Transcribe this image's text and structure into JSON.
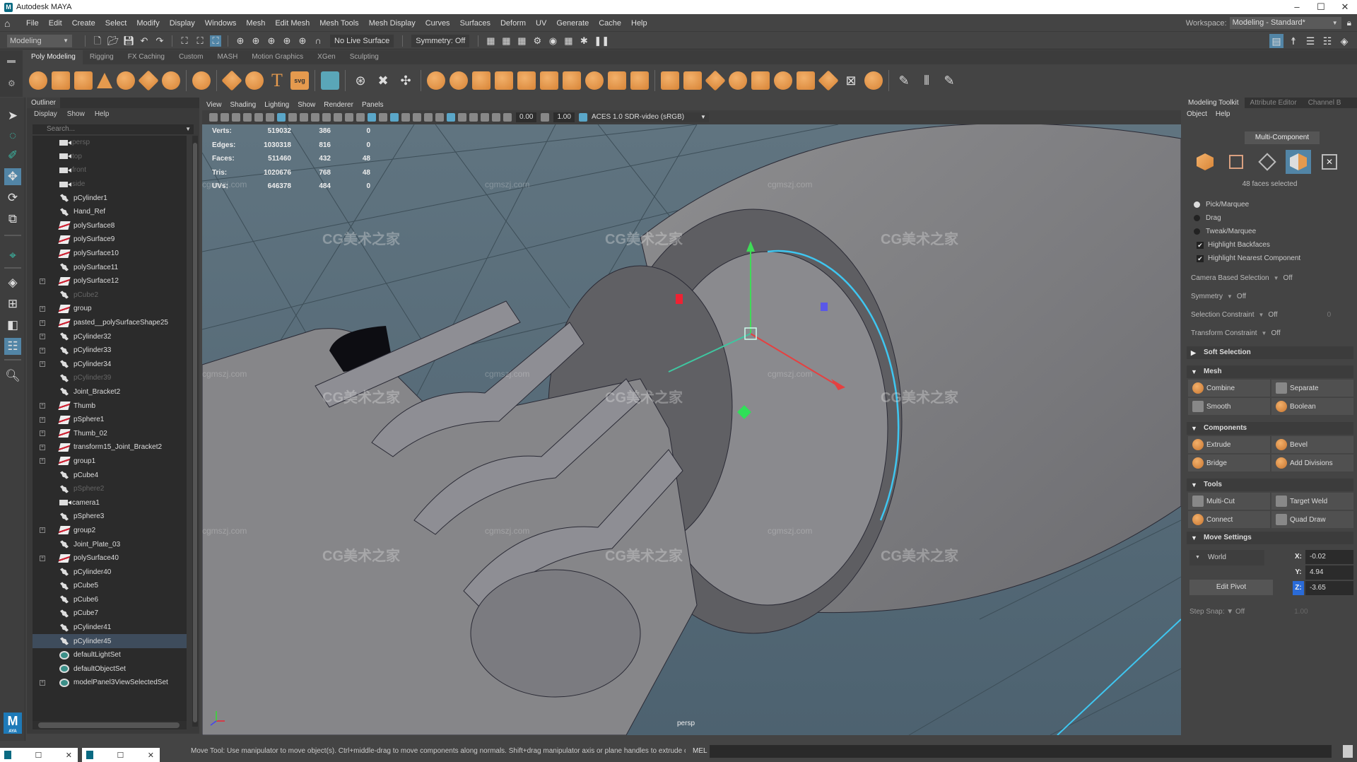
{
  "window": {
    "title": "Autodesk MAYA",
    "controls": [
      "–",
      "☐",
      "✕"
    ]
  },
  "menubar": {
    "items": [
      "File",
      "Edit",
      "Create",
      "Select",
      "Modify",
      "Display",
      "Windows",
      "Mesh",
      "Edit Mesh",
      "Mesh Tools",
      "Mesh Display",
      "Curves",
      "Surfaces",
      "Deform",
      "UV",
      "Generate",
      "Cache",
      "Help"
    ],
    "workspace_label": "Workspace:",
    "workspace_value": "Modeling - Standard*"
  },
  "statusline": {
    "mode": "Modeling",
    "live_surface": "No Live Surface",
    "symmetry": "Symmetry: Off"
  },
  "shelf": {
    "tabs": [
      "Poly Modeling",
      "Rigging",
      "FX Caching",
      "Custom",
      "MASH",
      "Motion Graphics",
      "XGen",
      "Sculpting"
    ],
    "active_tab": "Poly Modeling",
    "icons": [
      "poly-sphere",
      "poly-cube",
      "poly-cylinder",
      "poly-cone",
      "poly-torus",
      "poly-plane",
      "poly-disc",
      "platonic-solid",
      "super-shape",
      "sweep-mesh",
      "type",
      "svg",
      "poly-combine-grid",
      "mirror",
      "boolean",
      "smooth",
      "combine",
      "separate",
      "extract",
      "fill-hole",
      "reduce",
      "extrude",
      "bevel",
      "bridge",
      "add-divisions",
      "target-weld",
      "multi-cut",
      "quad-draw",
      "connect"
    ]
  },
  "outliner": {
    "title": "Outliner",
    "menu": [
      "Display",
      "Show",
      "Help"
    ],
    "search_placeholder": "Search...",
    "items": [
      {
        "name": "persp",
        "type": "camera",
        "dim": true,
        "expandable": false
      },
      {
        "name": "top",
        "type": "camera",
        "dim": true,
        "expandable": false
      },
      {
        "name": "front",
        "type": "camera",
        "dim": true,
        "expandable": false
      },
      {
        "name": "side",
        "type": "camera",
        "dim": true,
        "expandable": false
      },
      {
        "name": "pCylinder1",
        "type": "mesh",
        "dim": false,
        "expandable": false
      },
      {
        "name": "Hand_Ref",
        "type": "mesh",
        "dim": false,
        "expandable": false
      },
      {
        "name": "polySurface8",
        "type": "group",
        "dim": false,
        "expandable": false
      },
      {
        "name": "polySurface9",
        "type": "group",
        "dim": false,
        "expandable": false
      },
      {
        "name": "polySurface10",
        "type": "group",
        "dim": false,
        "expandable": false
      },
      {
        "name": "polySurface11",
        "type": "mesh",
        "dim": false,
        "expandable": false
      },
      {
        "name": "polySurface12",
        "type": "group",
        "dim": false,
        "expandable": true
      },
      {
        "name": "pCube2",
        "type": "mesh",
        "dim": true,
        "expandable": false
      },
      {
        "name": "group",
        "type": "group",
        "dim": false,
        "expandable": true
      },
      {
        "name": "pasted__polySurfaceShape25",
        "type": "group",
        "dim": false,
        "expandable": true
      },
      {
        "name": "pCylinder32",
        "type": "mesh",
        "dim": false,
        "expandable": true
      },
      {
        "name": "pCylinder33",
        "type": "mesh",
        "dim": false,
        "expandable": true
      },
      {
        "name": "pCylinder34",
        "type": "mesh",
        "dim": false,
        "expandable": true
      },
      {
        "name": "pCylinder39",
        "type": "mesh",
        "dim": true,
        "expandable": false
      },
      {
        "name": "Joint_Bracket2",
        "type": "mesh",
        "dim": false,
        "expandable": false
      },
      {
        "name": "Thumb",
        "type": "group",
        "dim": false,
        "expandable": true
      },
      {
        "name": "pSphere1",
        "type": "group",
        "dim": false,
        "expandable": true
      },
      {
        "name": "Thumb_02",
        "type": "group",
        "dim": false,
        "expandable": true
      },
      {
        "name": "transform15_Joint_Bracket2",
        "type": "group",
        "dim": false,
        "expandable": true
      },
      {
        "name": "group1",
        "type": "group",
        "dim": false,
        "expandable": true
      },
      {
        "name": "pCube4",
        "type": "mesh",
        "dim": false,
        "expandable": false
      },
      {
        "name": "pSphere2",
        "type": "mesh",
        "dim": true,
        "expandable": false
      },
      {
        "name": "camera1",
        "type": "camera",
        "dim": false,
        "expandable": false
      },
      {
        "name": "pSphere3",
        "type": "mesh",
        "dim": false,
        "expandable": false
      },
      {
        "name": "group2",
        "type": "group",
        "dim": false,
        "expandable": true
      },
      {
        "name": "Joint_Plate_03",
        "type": "mesh",
        "dim": false,
        "expandable": false
      },
      {
        "name": "polySurface40",
        "type": "group",
        "dim": false,
        "expandable": true
      },
      {
        "name": "pCylinder40",
        "type": "mesh",
        "dim": false,
        "expandable": false
      },
      {
        "name": "pCube5",
        "type": "mesh",
        "dim": false,
        "expandable": false
      },
      {
        "name": "pCube6",
        "type": "mesh",
        "dim": false,
        "expandable": false
      },
      {
        "name": "pCube7",
        "type": "mesh",
        "dim": false,
        "expandable": false
      },
      {
        "name": "pCylinder41",
        "type": "mesh",
        "dim": false,
        "expandable": false
      },
      {
        "name": "pCylinder45",
        "type": "mesh",
        "dim": false,
        "expandable": false,
        "selected": true
      },
      {
        "name": "defaultLightSet",
        "type": "set",
        "dim": false,
        "expandable": false
      },
      {
        "name": "defaultObjectSet",
        "type": "set",
        "dim": false,
        "expandable": false
      },
      {
        "name": "modelPanel3ViewSelectedSet",
        "type": "set",
        "dim": false,
        "expandable": true
      }
    ]
  },
  "viewport": {
    "menu": [
      "View",
      "Shading",
      "Lighting",
      "Show",
      "Renderer",
      "Panels"
    ],
    "exposure": "0.00",
    "gamma": "1.00",
    "color_space": "ACES 1.0 SDR-video (sRGB)",
    "camera_label": "persp",
    "hud": [
      {
        "label": "Verts:",
        "total": "519032",
        "selected": "386",
        "extra": "0"
      },
      {
        "label": "Edges:",
        "total": "1030318",
        "selected": "816",
        "extra": "0"
      },
      {
        "label": "Faces:",
        "total": "511460",
        "selected": "432",
        "extra": "48"
      },
      {
        "label": "Tris:",
        "total": "1020676",
        "selected": "768",
        "extra": "48"
      },
      {
        "label": "UVs:",
        "total": "646378",
        "selected": "484",
        "extra": "0"
      }
    ],
    "watermark": "CG美术之家",
    "watermark_url": "cgmszj.com"
  },
  "toolkit": {
    "tabs": [
      "Modeling Toolkit",
      "Attribute Editor",
      "Channel B"
    ],
    "menu": [
      "Object",
      "Help"
    ],
    "tooltip": "Multi-Component",
    "selection_status": "48 faces selected",
    "pick_modes": [
      {
        "label": "Pick/Marquee",
        "on": true
      },
      {
        "label": "Drag",
        "on": false
      },
      {
        "label": "Tweak/Marquee",
        "on": false
      }
    ],
    "checks": [
      {
        "label": "Highlight Backfaces",
        "checked": true
      },
      {
        "label": "Highlight Nearest Component",
        "checked": true
      }
    ],
    "dropdowns": [
      {
        "label": "Camera Based Selection",
        "value": "Off"
      },
      {
        "label": "Symmetry",
        "value": "Off"
      },
      {
        "label": "Selection Constraint",
        "value": "Off",
        "extra": "0"
      },
      {
        "label": "Transform Constraint",
        "value": "Off"
      }
    ],
    "soft_selection": "Soft Selection",
    "mesh_section": "Mesh",
    "mesh_buttons": [
      "Combine",
      "Separate",
      "Smooth",
      "Boolean"
    ],
    "components_section": "Components",
    "component_buttons": [
      "Extrude",
      "Bevel",
      "Bridge",
      "Add Divisions"
    ],
    "tools_section": "Tools",
    "tool_buttons": [
      "Multi-Cut",
      "Target Weld",
      "Connect",
      "Quad Draw"
    ],
    "move_settings": {
      "title": "Move Settings",
      "space": "World",
      "edit_pivot": "Edit Pivot",
      "x_label": "X:",
      "x": "-0.02",
      "y_label": "Y:",
      "y": "4.94",
      "z_label": "Z:",
      "z": "-3.65",
      "step_snap_label": "Step Snap:",
      "step_snap_value": "Off",
      "step_value": "1.00"
    }
  },
  "helpline": {
    "text": "Move Tool: Use manipulator to move object(s). Ctrl+middle-drag to move components along normals. Shift+drag manipulator axis or plane handles to extrude components or clone objects. Ctrl+Shift+drag to constrain movement to a",
    "cmd_lang": "MEL"
  }
}
